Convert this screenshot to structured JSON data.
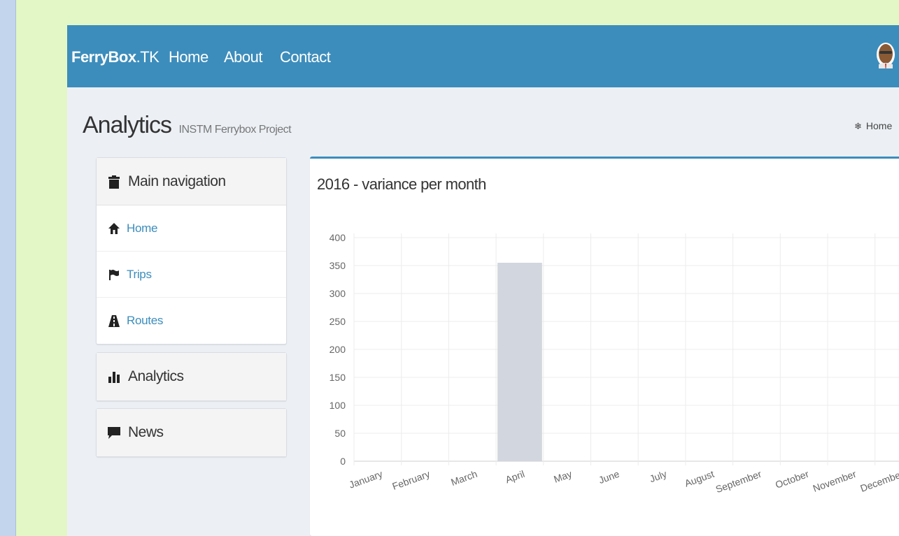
{
  "navbar": {
    "brand_bold": "FerryBox",
    "brand_rest": ".TK",
    "links": [
      "Home",
      "About",
      "Contact"
    ]
  },
  "page": {
    "title": "Analytics",
    "subtitle": "INSTM Ferrybox Project",
    "breadcrumb": "Home"
  },
  "sidebar": {
    "main_nav": {
      "header": "Main navigation",
      "items": [
        {
          "label": "Home",
          "icon": "home-icon"
        },
        {
          "label": "Trips",
          "icon": "flag-icon"
        },
        {
          "label": "Routes",
          "icon": "road-icon"
        }
      ]
    },
    "analytics": {
      "header": "Analytics",
      "icon": "bar-chart-icon"
    },
    "news": {
      "header": "News",
      "icon": "comment-icon"
    }
  },
  "chart_data": {
    "type": "bar",
    "title": "2016 - variance per month",
    "categories": [
      "January",
      "February",
      "March",
      "April",
      "May",
      "June",
      "July",
      "August",
      "September",
      "October",
      "November",
      "December"
    ],
    "values": [
      0,
      0,
      0,
      355,
      0,
      0,
      0,
      0,
      0,
      0,
      0,
      0
    ],
    "ylim": [
      0,
      400
    ],
    "yticks": [
      0,
      50,
      100,
      150,
      200,
      250,
      300,
      350,
      400
    ],
    "grid": true,
    "bar_color": "#d2d6de"
  },
  "colors": {
    "primary": "#3c8dbc",
    "background": "#ecf0f5"
  }
}
